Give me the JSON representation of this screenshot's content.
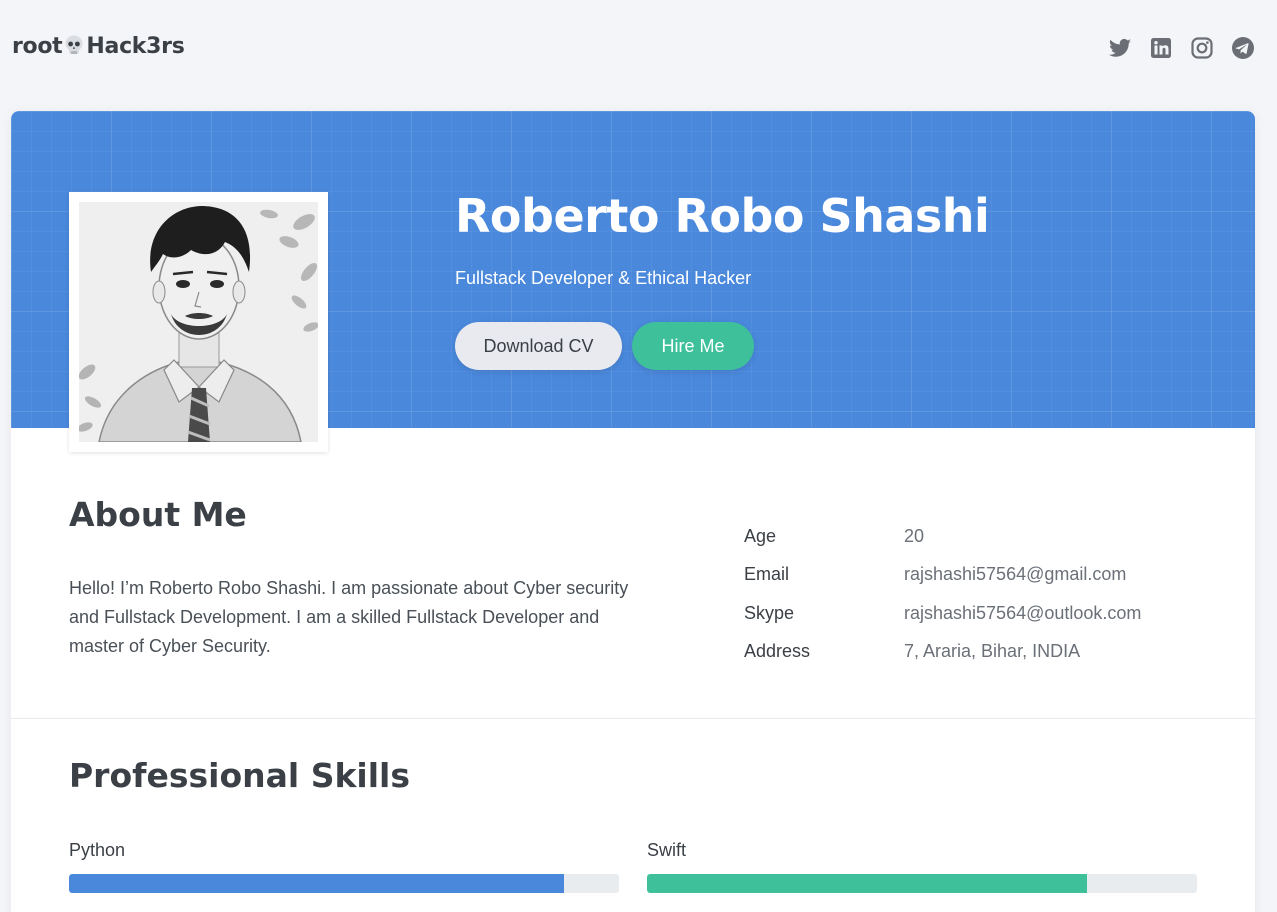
{
  "brand": {
    "prefix": "root",
    "suffix": "Hack3rs"
  },
  "socials": [
    {
      "icon": "twitter-icon",
      "label": "Twitter"
    },
    {
      "icon": "linkedin-icon",
      "label": "LinkedIn"
    },
    {
      "icon": "instagram-icon",
      "label": "Instagram"
    },
    {
      "icon": "telegram-icon",
      "label": "Telegram"
    }
  ],
  "hero": {
    "name": "Roberto Robo Shashi",
    "tagline": "Fullstack Developer & Ethical Hacker",
    "download_cv": "Download CV",
    "hire_me": "Hire Me"
  },
  "about": {
    "title": "About Me",
    "text": "Hello! I’m Roberto Robo Shashi. I am passionate about Cyber security and Fullstack Development. I am a skilled Fullstack Developer and master of Cyber Security.",
    "info": [
      {
        "label": "Age",
        "value": "20"
      },
      {
        "label": "Email",
        "value": "rajshashi57564@gmail.com"
      },
      {
        "label": "Skype",
        "value": "rajshashi57564@outlook.com"
      },
      {
        "label": "Address",
        "value": "7, Araria, Bihar, INDIA"
      }
    ]
  },
  "skills": {
    "title": "Professional Skills",
    "items": [
      {
        "name": "Python",
        "level": 0.9,
        "color": "#4a88dc"
      },
      {
        "name": "Swift",
        "level": 0.8,
        "color": "#3ec09a"
      }
    ]
  },
  "colors": {
    "hero": "#4a88dc",
    "accent_green": "#3ec09a",
    "text": "#3b4046"
  }
}
